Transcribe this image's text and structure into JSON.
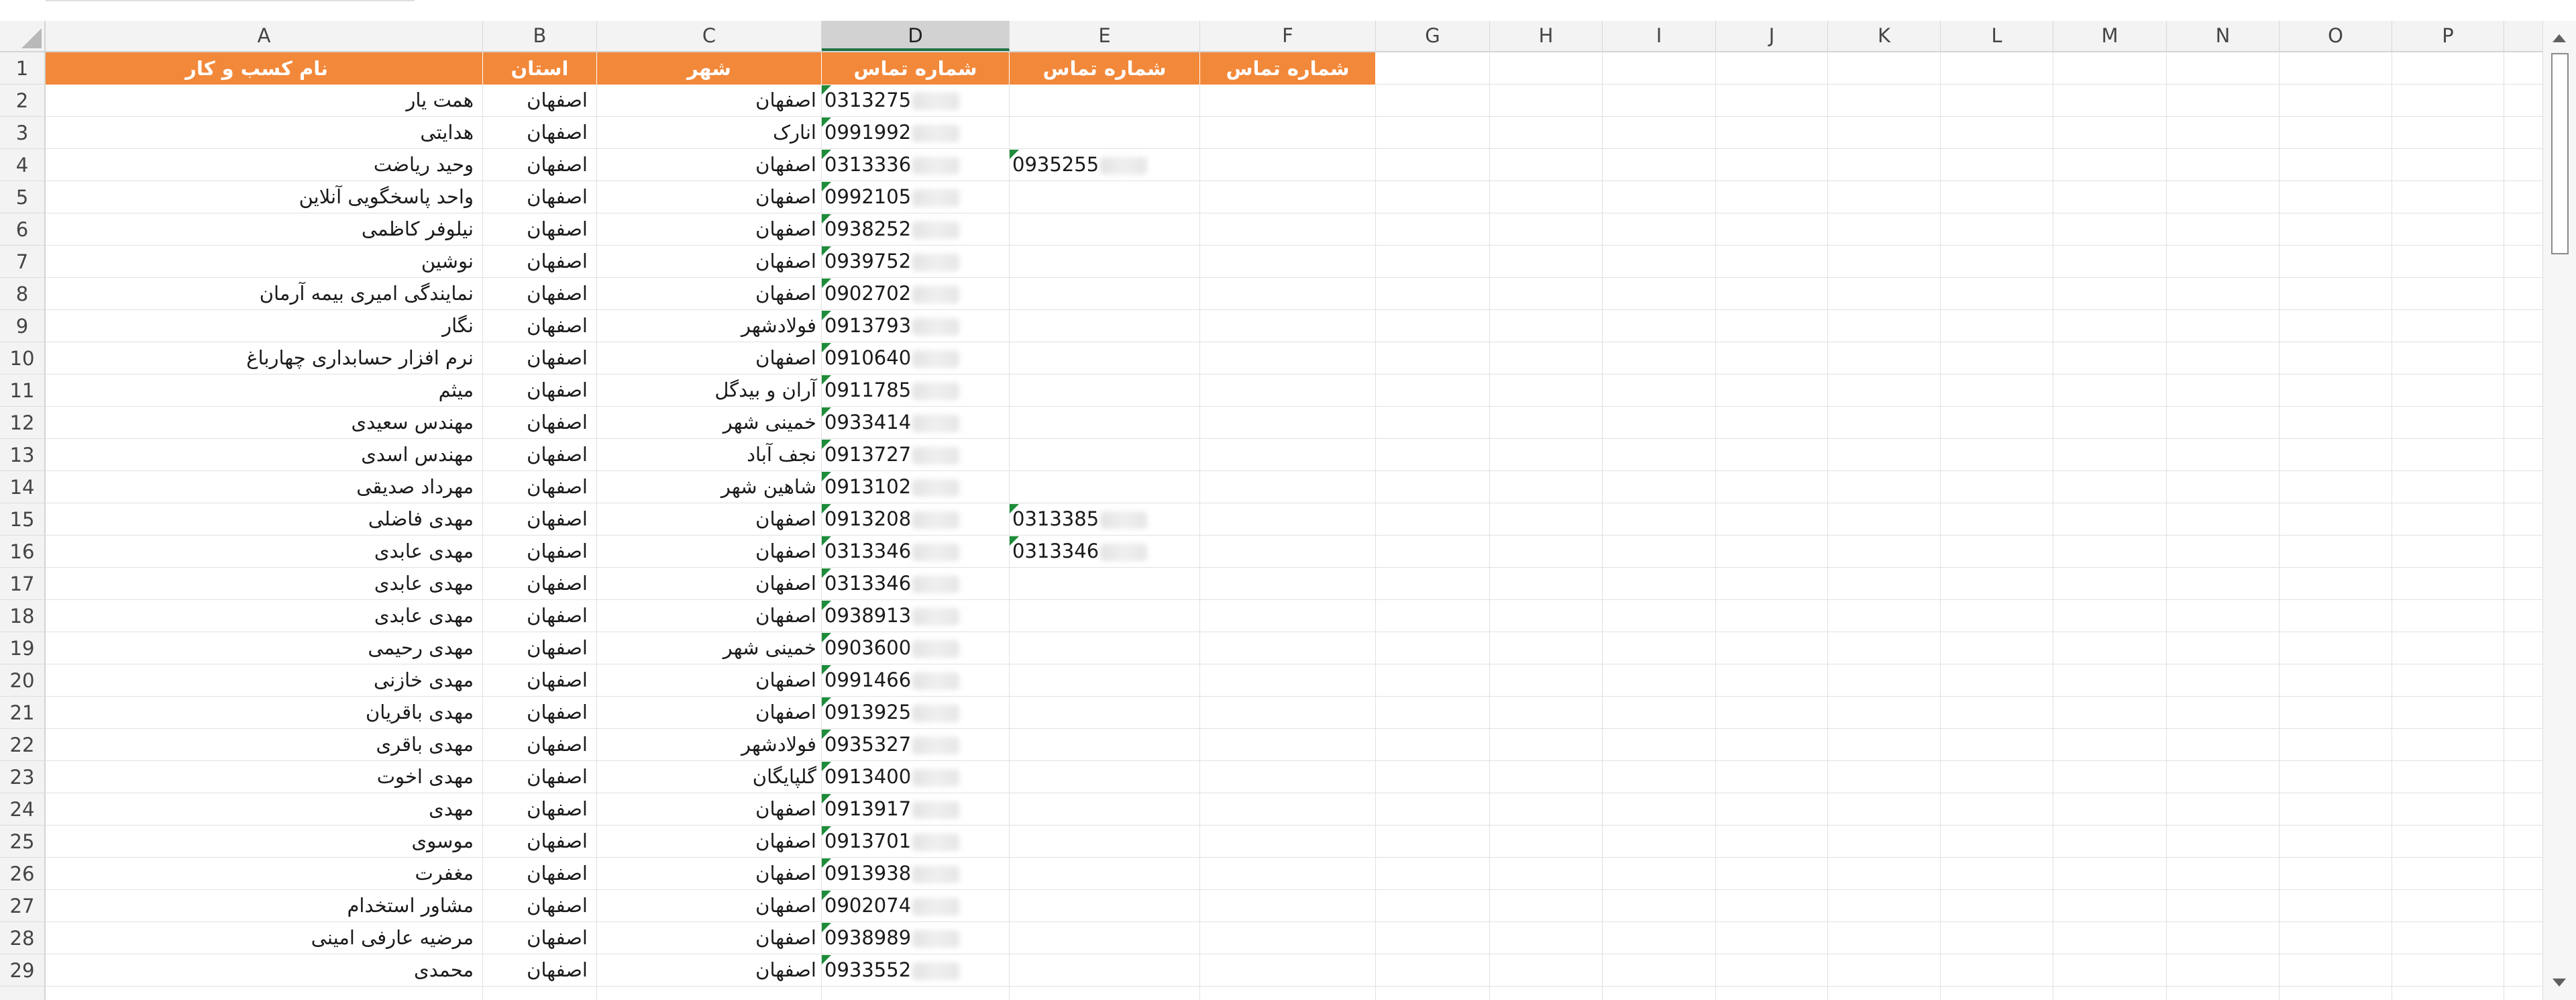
{
  "columns": [
    "A",
    "B",
    "C",
    "D",
    "E",
    "F",
    "G",
    "H",
    "I",
    "J",
    "K",
    "L",
    "M",
    "N",
    "O",
    "P"
  ],
  "selected_column": "D",
  "header_row": {
    "row_number": "1",
    "business_name": "نام کسب و کار",
    "province": "استان",
    "city": "شهر",
    "phone1": "شماره تماس",
    "phone2": "شماره تماس",
    "phone3": "شماره تماس"
  },
  "rows": [
    {
      "num": "2",
      "name": "همت یار",
      "province": "اصفهان",
      "city": "اصفهان",
      "phone": "0313275",
      "phone2": ""
    },
    {
      "num": "3",
      "name": "هدایتی",
      "province": "اصفهان",
      "city": "انارک",
      "phone": "0991992",
      "phone2": ""
    },
    {
      "num": "4",
      "name": "وحید ریاضت",
      "province": "اصفهان",
      "city": "اصفهان",
      "phone": "0313336",
      "phone2": "0935255"
    },
    {
      "num": "5",
      "name": "واحد پاسخگویی آنلاین",
      "province": "اصفهان",
      "city": "اصفهان",
      "phone": "0992105",
      "phone2": ""
    },
    {
      "num": "6",
      "name": "نیلوفر کاظمی",
      "province": "اصفهان",
      "city": "اصفهان",
      "phone": "0938252",
      "phone2": ""
    },
    {
      "num": "7",
      "name": "نوشین",
      "province": "اصفهان",
      "city": "اصفهان",
      "phone": "0939752",
      "phone2": ""
    },
    {
      "num": "8",
      "name": "نمایندگی امیری بیمه آرمان",
      "province": "اصفهان",
      "city": "اصفهان",
      "phone": "0902702",
      "phone2": ""
    },
    {
      "num": "9",
      "name": "نگار",
      "province": "اصفهان",
      "city": "فولادشهر",
      "phone": "0913793",
      "phone2": ""
    },
    {
      "num": "10",
      "name": "نرم افزار حسابداری چهارباغ",
      "province": "اصفهان",
      "city": "اصفهان",
      "phone": "0910640",
      "phone2": ""
    },
    {
      "num": "11",
      "name": "میثم",
      "province": "اصفهان",
      "city": "آران و بیدگل",
      "phone": "0911785",
      "phone2": ""
    },
    {
      "num": "12",
      "name": "مهندس سعیدی",
      "province": "اصفهان",
      "city": "خمینی شهر",
      "phone": "0933414",
      "phone2": ""
    },
    {
      "num": "13",
      "name": "مهندس اسدی",
      "province": "اصفهان",
      "city": "نجف آباد",
      "phone": "0913727",
      "phone2": ""
    },
    {
      "num": "14",
      "name": "مهرداد صدیقی",
      "province": "اصفهان",
      "city": "شاهین شهر",
      "phone": "0913102",
      "phone2": ""
    },
    {
      "num": "15",
      "name": "مهدی فاضلی",
      "province": "اصفهان",
      "city": "اصفهان",
      "phone": "0913208",
      "phone2": "0313385"
    },
    {
      "num": "16",
      "name": "مهدی عابدی",
      "province": "اصفهان",
      "city": "اصفهان",
      "phone": "0313346",
      "phone2": "0313346"
    },
    {
      "num": "17",
      "name": "مهدی عابدی",
      "province": "اصفهان",
      "city": "اصفهان",
      "phone": "0313346",
      "phone2": ""
    },
    {
      "num": "18",
      "name": "مهدی عابدی",
      "province": "اصفهان",
      "city": "اصفهان",
      "phone": "0938913",
      "phone2": ""
    },
    {
      "num": "19",
      "name": "مهدی رحیمی",
      "province": "اصفهان",
      "city": "خمینی شهر",
      "phone": "0903600",
      "phone2": ""
    },
    {
      "num": "20",
      "name": "مهدی خازنی",
      "province": "اصفهان",
      "city": "اصفهان",
      "phone": "0991466",
      "phone2": ""
    },
    {
      "num": "21",
      "name": "مهدی باقریان",
      "province": "اصفهان",
      "city": "اصفهان",
      "phone": "0913925",
      "phone2": ""
    },
    {
      "num": "22",
      "name": "مهدی باقری",
      "province": "اصفهان",
      "city": "فولادشهر",
      "phone": "0935327",
      "phone2": ""
    },
    {
      "num": "23",
      "name": "مهدی اخوت",
      "province": "اصفهان",
      "city": "گلپایگان",
      "phone": "0913400",
      "phone2": ""
    },
    {
      "num": "24",
      "name": "مهدی",
      "province": "اصفهان",
      "city": "اصفهان",
      "phone": "0913917",
      "phone2": ""
    },
    {
      "num": "25",
      "name": "موسوی",
      "province": "اصفهان",
      "city": "اصفهان",
      "phone": "0913701",
      "phone2": ""
    },
    {
      "num": "26",
      "name": "مغفرت",
      "province": "اصفهان",
      "city": "اصفهان",
      "phone": "0913938",
      "phone2": ""
    },
    {
      "num": "27",
      "name": "مشاور استخدام",
      "province": "اصفهان",
      "city": "اصفهان",
      "phone": "0902074",
      "phone2": ""
    },
    {
      "num": "28",
      "name": "مرضیه عارفی امینی",
      "province": "اصفهان",
      "city": "اصفهان",
      "phone": "0938989",
      "phone2": ""
    },
    {
      "num": "29",
      "name": "محمدی",
      "province": "اصفهان",
      "city": "اصفهان",
      "phone": "0933552",
      "phone2": ""
    }
  ],
  "colors": {
    "header_fill": "#f2883a",
    "header_text": "#ffffff",
    "error_triangle": "#1e8c3a",
    "selected_column_underline": "#217346"
  }
}
